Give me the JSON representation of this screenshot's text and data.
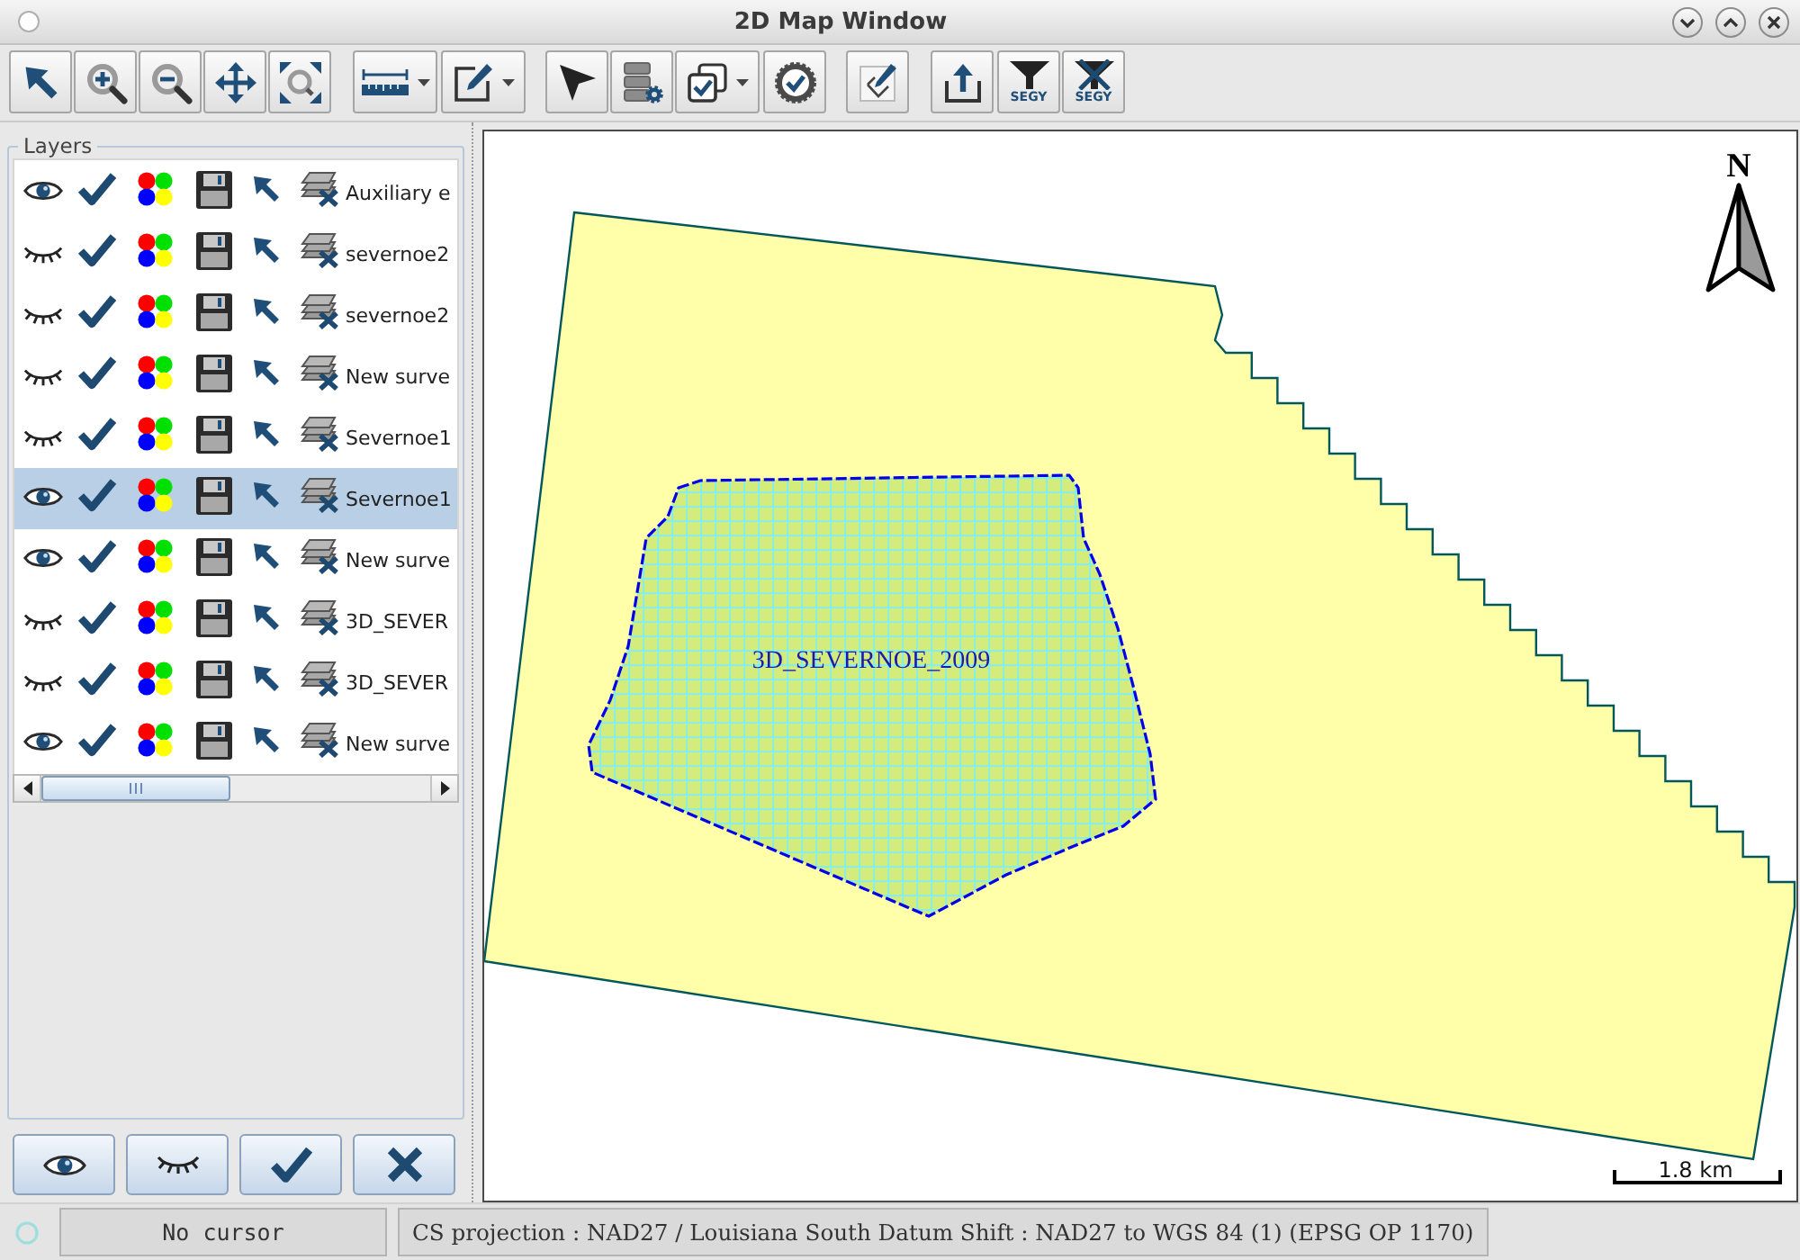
{
  "window": {
    "title": "2D Map Window"
  },
  "toolbar": {
    "filter_buttons": [
      {
        "label": "SEGY",
        "crossed": false
      },
      {
        "label": "SEGY",
        "crossed": true
      }
    ]
  },
  "layers_panel": {
    "title": "Layers",
    "rows": [
      {
        "name": "Auxiliary e",
        "visible": true,
        "checked": true,
        "selected": false
      },
      {
        "name": "severnoe2",
        "visible": false,
        "checked": true,
        "selected": false
      },
      {
        "name": "severnoe2",
        "visible": false,
        "checked": true,
        "selected": false
      },
      {
        "name": "New surve",
        "visible": false,
        "checked": true,
        "selected": false
      },
      {
        "name": "Severnoe1",
        "visible": false,
        "checked": true,
        "selected": false
      },
      {
        "name": "Severnoe1",
        "visible": true,
        "checked": true,
        "selected": true
      },
      {
        "name": "New surve",
        "visible": true,
        "checked": true,
        "selected": false
      },
      {
        "name": "3D_SEVER",
        "visible": false,
        "checked": true,
        "selected": false
      },
      {
        "name": "3D_SEVER",
        "visible": false,
        "checked": true,
        "selected": false
      },
      {
        "name": "New surve",
        "visible": true,
        "checked": true,
        "selected": false
      }
    ]
  },
  "map": {
    "north_label": "N",
    "survey_label": "3D_SEVERNOE_2009",
    "scale_label": "1.8 km"
  },
  "status_bar": {
    "cursor": "No cursor",
    "projection": "CS projection : NAD27 / Louisiana South Datum Shift : NAD27 to WGS 84 (1) (EPSG OP 1170)"
  }
}
